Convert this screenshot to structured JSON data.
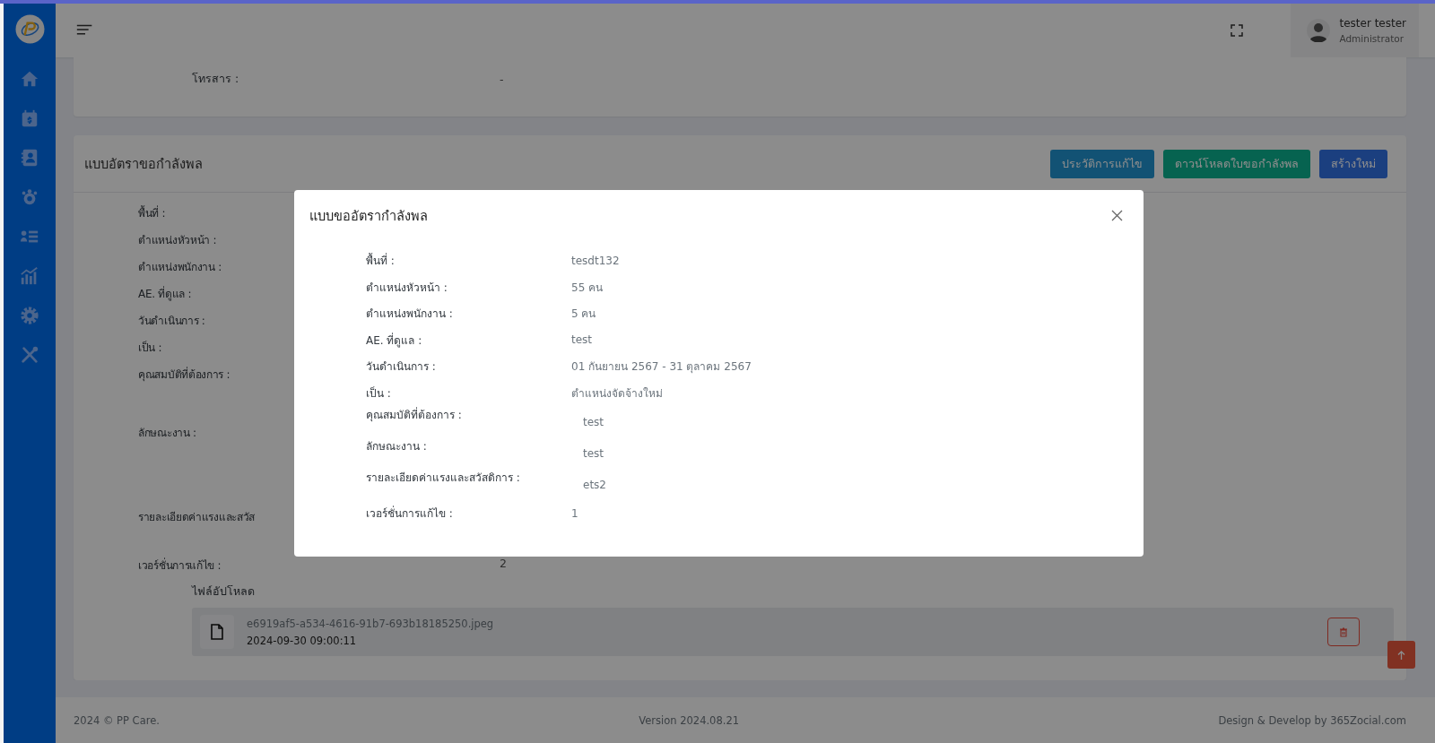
{
  "topbar": {
    "user_name": "tester tester",
    "user_role": "Administrator"
  },
  "contact_card": {
    "rows": [
      {
        "label": "โทรสาร :",
        "value": "-"
      }
    ]
  },
  "request_card": {
    "title": "แบบอัตราขอกำลังพล",
    "buttons": [
      {
        "label": "ประวัติการแก้ไข",
        "kind": "history"
      },
      {
        "label": "ดาวน์โหลดใบขอกำลังพล",
        "kind": "download"
      },
      {
        "label": "สร้างใหม่",
        "kind": "create"
      }
    ],
    "rows": [
      {
        "label": "พื้นที่ :"
      },
      {
        "label": "ตำแหน่งหัวหน้า :"
      },
      {
        "label": "ตำแหน่งพนักงาน :"
      },
      {
        "label": "AE. ที่ดูแล :"
      },
      {
        "label": "วันดำเนินการ :"
      },
      {
        "label": "เป็น :"
      },
      {
        "label": "คุณสมบัติที่ต้องการ :"
      },
      {
        "label": "ลักษณะงาน :"
      },
      {
        "label": "รายละเอียดค่าแรงและสวัส"
      },
      {
        "label": "เวอร์ชั่นการแก้ไข :",
        "value": "2"
      }
    ],
    "uploads_label": "ไฟล์อัปโหลด",
    "files": [
      {
        "name": "e6919af5-a534-4616-91b7-693b18185250.jpeg",
        "date": "2024-09-30 09:00:11"
      }
    ]
  },
  "modal": {
    "title": "แบบขออัตรากำลังพล",
    "rows": [
      {
        "label": "พื้นที่ :",
        "value": "tesdt132",
        "kind": "inline"
      },
      {
        "label": "ตำแหน่งหัวหน้า :",
        "value": "55 คน",
        "kind": "inline"
      },
      {
        "label": "ตำแหน่งพนักงาน :",
        "value": "5 คน",
        "kind": "inline"
      },
      {
        "label": "AE. ที่ดูแล :",
        "value": "test",
        "kind": "inline"
      },
      {
        "label": "วันดำเนินการ :",
        "value": "01 กันยายน 2567 - 31 ตุลาคม 2567",
        "kind": "inline"
      },
      {
        "label": "เป็น :",
        "value": "ตำแหน่งจัดจ้างใหม่",
        "kind": "inline"
      },
      {
        "label": "คุณสมบัติที่ต้องการ :",
        "value": "test",
        "kind": "block"
      },
      {
        "label": "ลักษณะงาน :",
        "value": "test",
        "kind": "block"
      },
      {
        "label": "รายละเอียดค่าแรงและสวัสดิการ :",
        "value": "ets2",
        "kind": "block"
      },
      {
        "label": "เวอร์ชั่นการแก้ไข :",
        "value": "1",
        "kind": "inline"
      }
    ]
  },
  "footer": {
    "copyright": "2024 © PP Care.",
    "version": "Version 2024.08.21",
    "credit": "Design & Develop by 365Zocial.com"
  }
}
